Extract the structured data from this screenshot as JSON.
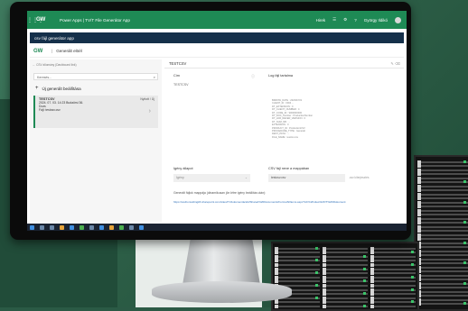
{
  "topbar": {
    "waffle": "⋮⋮⋮",
    "logo": "GW",
    "title": "Power Apps | TV/T File Generátor App",
    "right_items": [
      "Hirek",
      "☰",
      "⚙",
      "?",
      "György Ildikó"
    ]
  },
  "appbar": {
    "title": "csv fájl generátor app"
  },
  "subbar": {
    "logo": "GW",
    "sep": "|",
    "label": "Generált elöél"
  },
  "left": {
    "back_link": "← CSV állomány (Dashboard link)",
    "search_placeholder": "Keresés...",
    "new_record": "Új generált beállítása",
    "card": {
      "title": "TESTCSV",
      "badge": "Nyitott / Új",
      "line1": "2024. 07. 03. 14:23 Budaörsi 36.",
      "line2": "Dozs",
      "line3": "Fájl: testcsv.csv"
    }
  },
  "main": {
    "header": "TESTCSV",
    "header_icons": "✎  ⌫",
    "name_label": "Cím",
    "name_value": "TESTCSV",
    "log_label": "Log fájl tartalma",
    "log_text": "BRROW_DATE : 2023/07/21\nCLIENT_ID : 0004 ...\nDT_EXTENSION : 0\nDT_CLIENT_NUMBER : 4\nDT_CODE_ID : 9000000000\nDT_DOC_Number : ProductionNumber\nDT_LDR_REFER_VERSION : 0\nDT_NUM_NB : ...\nEXTENSION : 0\nPRODUCT_ID : ProductionCSV\nPROCEDURE_TYPE : Generalt\nDEST_PATH : ...\nFILE_NAME : testcsv.csv",
    "sync_label": "Igény állapot",
    "sync_value": "Igény",
    "csv_label": "CSV fájl neve a mappában",
    "csv_value": "testcsv.csv",
    "csv_ext": ".csv kiterjesztés",
    "note": "Generált fájlok mappája (dinamikusan jön létre igény beállítás után):",
    "link": "https://ewfconsultingkft.sharepoint.com/sites/IT-Dokumentációk/Shared%20Documents/Forms/AllItems.aspx?id=%2Fsites%2FIT%2DDokument"
  },
  "colors": {
    "topbar": "#1e8a55",
    "appbar": "#15304a",
    "accent": "#1e8a55"
  }
}
